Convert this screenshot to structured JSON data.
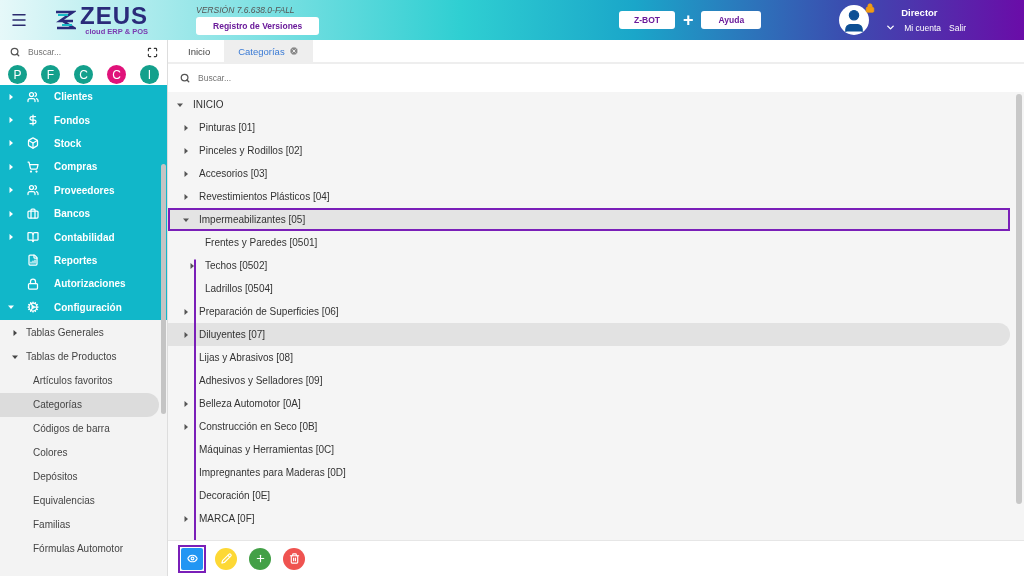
{
  "header": {
    "logo": {
      "name": "ZEUS",
      "tagline": "cloud ERP & POS"
    },
    "version": "VERSIÓN 7.6.638.0-FALL",
    "changelog_button": "Registro de Versiones",
    "zbot_button": "Z-BOT",
    "plus_sign": "+",
    "help_button": "Ayuda",
    "user": {
      "name": "Director",
      "account_link": "Mi cuenta",
      "logout_link": "Salir",
      "locked": true
    }
  },
  "sidebar": {
    "search": {
      "placeholder": "Buscar..."
    },
    "shortcuts": [
      {
        "label": "P",
        "color": "#13a08c"
      },
      {
        "label": "F",
        "color": "#13a08c"
      },
      {
        "label": "C",
        "color": "#13a08c"
      },
      {
        "label": "C",
        "color": "#e0127a"
      },
      {
        "label": "I",
        "color": "#13a08c"
      }
    ],
    "menu": [
      {
        "label": "Clientes",
        "kind": "people",
        "expandable": true,
        "expanded": false
      },
      {
        "label": "Fondos",
        "kind": "dollar",
        "expandable": true,
        "expanded": false
      },
      {
        "label": "Stock",
        "kind": "box",
        "expandable": true,
        "expanded": false
      },
      {
        "label": "Compras",
        "kind": "cart",
        "expandable": true,
        "expanded": false
      },
      {
        "label": "Proveedores",
        "kind": "people",
        "expandable": true,
        "expanded": false
      },
      {
        "label": "Bancos",
        "kind": "briefcase",
        "expandable": true,
        "expanded": false
      },
      {
        "label": "Contabilidad",
        "kind": "book",
        "expandable": true,
        "expanded": false
      },
      {
        "label": "Reportes",
        "kind": "report",
        "expandable": false
      },
      {
        "label": "Autorizaciones",
        "kind": "lock",
        "expandable": false
      },
      {
        "label": "Configuración",
        "kind": "gears",
        "expandable": true,
        "expanded": true
      }
    ],
    "submenu": [
      {
        "label": "Tablas Generales",
        "expanded": false
      },
      {
        "label": "Tablas de Productos",
        "expanded": true,
        "children": [
          {
            "label": "Artículos favoritos",
            "selected": false
          },
          {
            "label": "Categorías",
            "selected": true
          },
          {
            "label": "Códigos de barra",
            "selected": false
          },
          {
            "label": "Colores",
            "selected": false
          },
          {
            "label": "Depósitos",
            "selected": false
          },
          {
            "label": "Equivalencias",
            "selected": false
          },
          {
            "label": "Familias",
            "selected": false
          },
          {
            "label": "Fórmulas Automotor",
            "selected": false
          }
        ]
      }
    ]
  },
  "tabs": [
    {
      "label": "Inicio",
      "selected": false,
      "closable": false
    },
    {
      "label": "Categorías",
      "selected": true,
      "closable": true
    }
  ],
  "search": {
    "placeholder": "Buscar..."
  },
  "tree": [
    {
      "label": "INICIO",
      "expanded": true,
      "selected": false,
      "hovered": false,
      "children": [
        {
          "label": "Pinturas [01]",
          "expanded": false,
          "selected": false,
          "hovered": false,
          "expandable": true
        },
        {
          "label": "Pinceles y Rodillos [02]",
          "expanded": false,
          "selected": false,
          "hovered": false,
          "expandable": true
        },
        {
          "label": "Accesorios [03]",
          "expanded": false,
          "selected": false,
          "hovered": false,
          "expandable": true
        },
        {
          "label": "Revestimientos Plásticos [04]",
          "expanded": false,
          "selected": false,
          "hovered": false,
          "expandable": true
        },
        {
          "label": "Impermeabilizantes [05]",
          "expanded": true,
          "selected": true,
          "hovered": false,
          "expandable": true,
          "children": [
            {
              "label": "Frentes y Paredes [0501]",
              "expanded": false,
              "selected": false,
              "hovered": false,
              "expandable": false
            },
            {
              "label": "Techos [0502]",
              "expanded": false,
              "selected": false,
              "hovered": false,
              "expandable": true
            },
            {
              "label": "Ladrillos [0504]",
              "expanded": false,
              "selected": false,
              "hovered": false,
              "expandable": false
            }
          ]
        },
        {
          "label": "Preparación de Superficies [06]",
          "expanded": false,
          "selected": false,
          "hovered": false,
          "expandable": true
        },
        {
          "label": "Diluyentes [07]",
          "expanded": false,
          "selected": false,
          "hovered": true,
          "expandable": true
        },
        {
          "label": "Lijas y Abrasivos [08]",
          "expanded": false,
          "selected": false,
          "hovered": false,
          "expandable": false
        },
        {
          "label": "Adhesivos y Selladores [09]",
          "expanded": false,
          "selected": false,
          "hovered": false,
          "expandable": false
        },
        {
          "label": "Belleza Automotor [0A]",
          "expanded": false,
          "selected": false,
          "hovered": false,
          "expandable": true
        },
        {
          "label": "Construcción en Seco [0B]",
          "expanded": false,
          "selected": false,
          "hovered": false,
          "expandable": true
        },
        {
          "label": "Máquinas y Herramientas [0C]",
          "expanded": false,
          "selected": false,
          "hovered": false,
          "expandable": false
        },
        {
          "label": "Impregnantes para Maderas [0D]",
          "expanded": false,
          "selected": false,
          "hovered": false,
          "expandable": false
        },
        {
          "label": "Decoración [0E]",
          "expanded": false,
          "selected": false,
          "hovered": false,
          "expandable": false
        },
        {
          "label": "MARCA [0F]",
          "expanded": false,
          "selected": false,
          "hovered": false,
          "expandable": true
        }
      ]
    }
  ],
  "actions": [
    {
      "kind": "view",
      "highlighted": true
    },
    {
      "kind": "edit",
      "highlighted": false
    },
    {
      "kind": "add",
      "highlighted": false
    },
    {
      "kind": "delete",
      "highlighted": false
    }
  ]
}
